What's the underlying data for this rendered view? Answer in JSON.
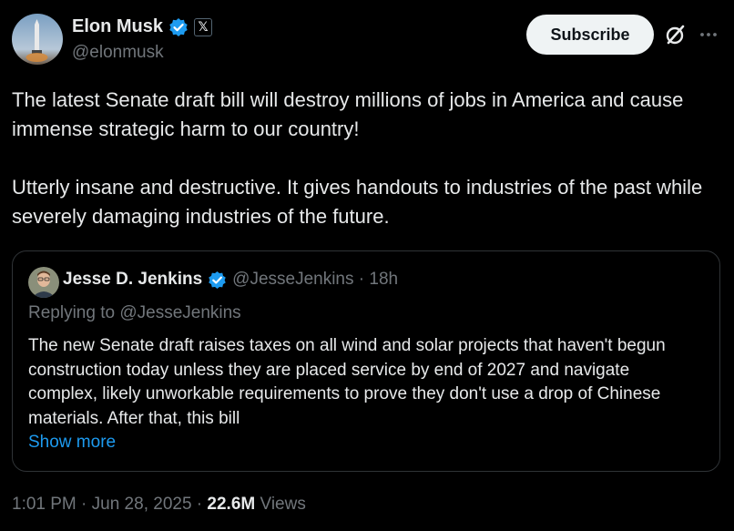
{
  "author": {
    "name": "Elon Musk",
    "handle": "@elonmusk",
    "avatar_icon": "rocket-avatar",
    "verified_color": "#1d9bf0",
    "x_badge": "𝕏"
  },
  "actions": {
    "subscribe_label": "Subscribe",
    "grok_icon": "grok-icon",
    "more_icon": "more-icon"
  },
  "post": {
    "paragraph_1": "The latest Senate draft bill will destroy millions of jobs in America and cause immense strategic harm to our country!",
    "paragraph_2": "Utterly insane and destructive. It gives handouts to industries of the past while severely damaging industries of the future."
  },
  "quoted": {
    "name": "Jesse D. Jenkins",
    "handle_time": "@JesseJenkins · 18h",
    "replying": "Replying to @JesseJenkins",
    "text": "The new Senate draft raises taxes on all wind and solar projects that haven't begun construction today unless they are placed service by end of 2027 and navigate complex, likely unworkable requirements to prove they don't use a drop of Chinese materials. After that, this bill",
    "show_more": "Show more"
  },
  "meta": {
    "timestamp": "1:01 PM · Jun 28, 2025 · ",
    "views_count": "22.6M",
    "views_label": "Views"
  }
}
